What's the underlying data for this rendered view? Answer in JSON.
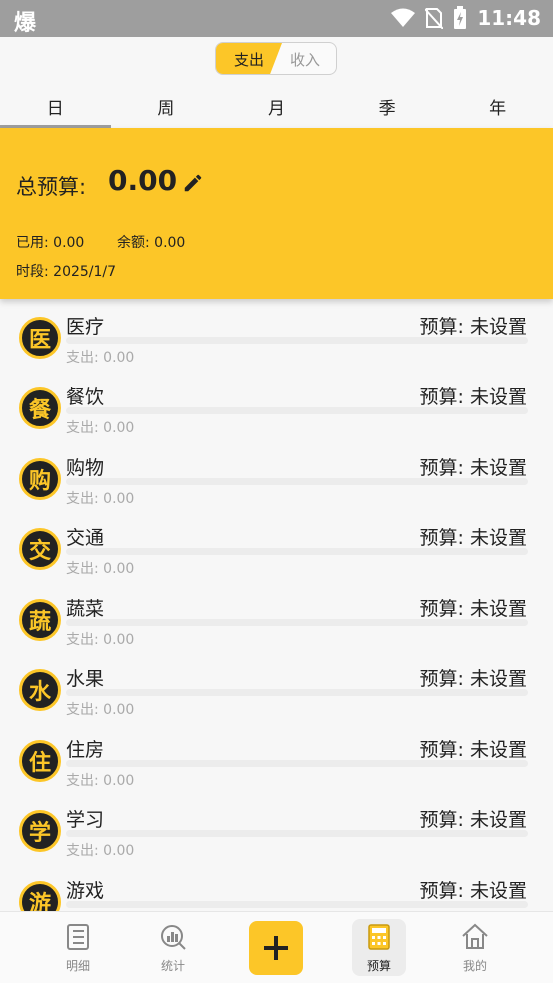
{
  "status": {
    "left_glyph": "爆",
    "time": "11:48"
  },
  "segment": {
    "expense": "支出",
    "income": "收入"
  },
  "tabs": [
    "日",
    "周",
    "月",
    "季",
    "年"
  ],
  "budget": {
    "total_label": "总预算:",
    "total_value": "0.00",
    "used": "已用:  0.00",
    "remaining": "余额:  0.00",
    "period": "时段: 2025/1/7"
  },
  "categories": [
    {
      "glyph": "医",
      "name": "医疗",
      "budget": "预算: 未设置",
      "spent": "支出: 0.00"
    },
    {
      "glyph": "餐",
      "name": "餐饮",
      "budget": "预算: 未设置",
      "spent": "支出: 0.00"
    },
    {
      "glyph": "购",
      "name": "购物",
      "budget": "预算: 未设置",
      "spent": "支出: 0.00"
    },
    {
      "glyph": "交",
      "name": "交通",
      "budget": "预算: 未设置",
      "spent": "支出: 0.00"
    },
    {
      "glyph": "蔬",
      "name": "蔬菜",
      "budget": "预算: 未设置",
      "spent": "支出: 0.00"
    },
    {
      "glyph": "水",
      "name": "水果",
      "budget": "预算: 未设置",
      "spent": "支出: 0.00"
    },
    {
      "glyph": "住",
      "name": "住房",
      "budget": "预算: 未设置",
      "spent": "支出: 0.00"
    },
    {
      "glyph": "学",
      "name": "学习",
      "budget": "预算: 未设置",
      "spent": "支出: 0.00"
    },
    {
      "glyph": "游",
      "name": "游戏",
      "budget": "预算: 未设置",
      "spent": ""
    }
  ],
  "nav": {
    "details": "明细",
    "stats": "统计",
    "budget": "预算",
    "mine": "我的"
  },
  "colors": {
    "accent": "#fcc628",
    "statusbar": "#9e9e9e"
  }
}
